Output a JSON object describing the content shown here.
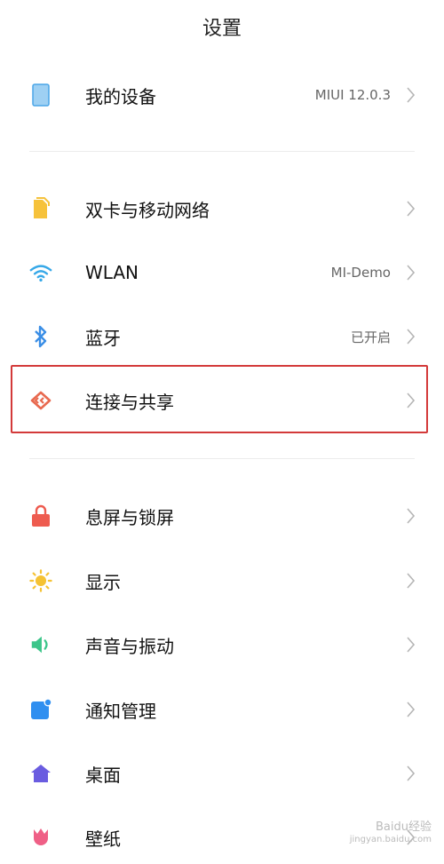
{
  "header": {
    "title": "设置"
  },
  "groups": {
    "device": {
      "label": "我的设备",
      "value": "MIUI 12.0.3"
    },
    "connectivity": [
      {
        "label": "双卡与移动网络",
        "value": ""
      },
      {
        "label": "WLAN",
        "value": "MI-Demo"
      },
      {
        "label": "蓝牙",
        "value": "已开启"
      },
      {
        "label": "连接与共享",
        "value": ""
      }
    ],
    "general": [
      {
        "label": "息屏与锁屏"
      },
      {
        "label": "显示"
      },
      {
        "label": "声音与振动"
      },
      {
        "label": "通知管理"
      },
      {
        "label": "桌面"
      },
      {
        "label": "壁纸"
      }
    ]
  },
  "colors": {
    "highlight_border": "#d33a3a",
    "chevron": "#b5b5b5"
  },
  "icons": {
    "device": "phone-icon",
    "sim": "sim-card-icon",
    "wlan": "wifi-icon",
    "bluetooth": "bluetooth-icon",
    "share": "connection-share-icon",
    "lock": "lock-icon",
    "display": "sun-icon",
    "sound": "speaker-icon",
    "notification": "notification-icon",
    "home": "home-icon",
    "wallpaper": "tulip-icon"
  },
  "watermark": {
    "text": "Baidu经验",
    "subtext": "jingyan.baidu.com"
  }
}
